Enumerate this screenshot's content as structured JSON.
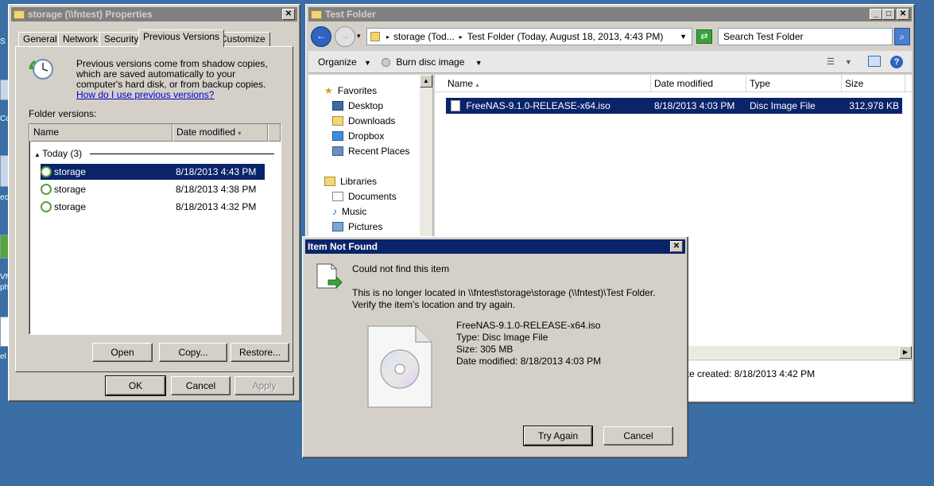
{
  "desktop": {
    "edge_labels": [
      "S",
      "Co",
      "ec",
      "VN",
      "phe",
      "el"
    ]
  },
  "properties_window": {
    "title": "storage (\\\\fntest) Properties",
    "tabs": [
      "General",
      "Network",
      "Security",
      "Previous Versions",
      "Customize"
    ],
    "selected_tab": "Previous Versions",
    "description": "Previous versions come from shadow copies, which are saved automatically to your computer's hard disk, or from backup copies.",
    "help_link": "How do I use previous versions?",
    "folder_versions_label": "Folder versions:",
    "columns": [
      "Name",
      "Date modified"
    ],
    "group_label": "Today (3)",
    "versions": [
      {
        "name": "storage",
        "date": "8/18/2013 4:43 PM",
        "selected": true
      },
      {
        "name": "storage",
        "date": "8/18/2013 4:38 PM",
        "selected": false
      },
      {
        "name": "storage",
        "date": "8/18/2013 4:32 PM",
        "selected": false
      }
    ],
    "buttons": {
      "open": "Open",
      "copy": "Copy...",
      "restore": "Restore...",
      "ok": "OK",
      "cancel": "Cancel",
      "apply": "Apply"
    }
  },
  "explorer_window": {
    "title": "Test Folder",
    "breadcrumb": [
      "storage (Tod...",
      "Test Folder (Today, August 18, 2013, 4:43 PM)"
    ],
    "search_placeholder": "Search Test Folder",
    "toolbar": {
      "organize": "Organize",
      "burn": "Burn disc image"
    },
    "nav": {
      "favorites": "Favorites",
      "favorite_items": [
        "Desktop",
        "Downloads",
        "Dropbox",
        "Recent Places"
      ],
      "libraries": "Libraries",
      "library_items": [
        "Documents",
        "Music",
        "Pictures"
      ]
    },
    "columns": [
      "Name",
      "Date modified",
      "Type",
      "Size"
    ],
    "files": [
      {
        "name": "FreeNAS-9.1.0-RELEASE-x64.iso",
        "date": "8/18/2013 4:03 PM",
        "type": "Disc Image File",
        "size": "312,978 KB"
      }
    ],
    "details_text": "ate created: 8/18/2013 4:42 PM"
  },
  "dialog": {
    "title": "Item Not Found",
    "heading": "Could not find this item",
    "message_line1": "This is no longer located in \\\\fntest\\storage\\storage (\\\\fntest)\\Test Folder.",
    "message_line2": "Verify the item's location and try again.",
    "file_name": "FreeNAS-9.1.0-RELEASE-x64.iso",
    "file_type": "Type: Disc Image File",
    "file_size": "Size: 305 MB",
    "file_modified": "Date modified: 8/18/2013 4:03 PM",
    "try_again": "Try Again",
    "cancel": "Cancel"
  },
  "colors": {
    "desktop": "#3a6ea5",
    "title_active": "#0a246a",
    "title_inactive": "#808080",
    "selection": "#0a246a"
  }
}
